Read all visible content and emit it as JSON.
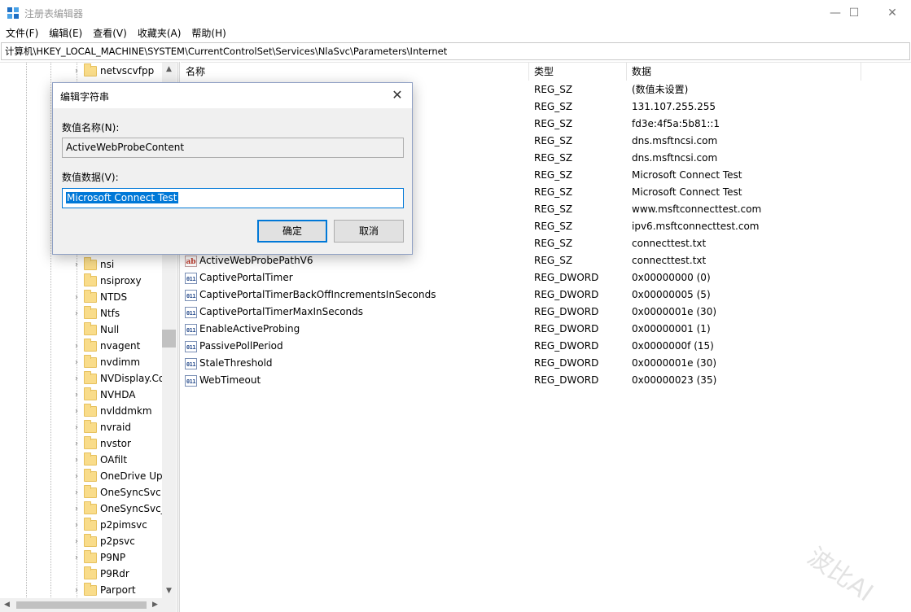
{
  "window": {
    "title": "注册表编辑器",
    "minimize_glyph": "—",
    "maximize_glyph": "☐",
    "close_glyph": "✕"
  },
  "menu": [
    {
      "label": "文件(F)"
    },
    {
      "label": "编辑(E)"
    },
    {
      "label": "查看(V)"
    },
    {
      "label": "收藏夹(A)"
    },
    {
      "label": "帮助(H)"
    }
  ],
  "address": "计算机\\HKEY_LOCAL_MACHINE\\SYSTEM\\CurrentControlSet\\Services\\NlaSvc\\Parameters\\Internet",
  "tree": {
    "items": [
      {
        "label": "netvscvfpp",
        "expandable": true
      },
      {
        "label": "nsi",
        "expandable": true
      },
      {
        "label": "nsiproxy",
        "expandable": false
      },
      {
        "label": "NTDS",
        "expandable": true
      },
      {
        "label": "Ntfs",
        "expandable": true
      },
      {
        "label": "Null",
        "expandable": false
      },
      {
        "label": "nvagent",
        "expandable": true
      },
      {
        "label": "nvdimm",
        "expandable": true
      },
      {
        "label": "NVDisplay.Co",
        "expandable": true
      },
      {
        "label": "NVHDA",
        "expandable": true
      },
      {
        "label": "nvlddmkm",
        "expandable": true
      },
      {
        "label": "nvraid",
        "expandable": true
      },
      {
        "label": "nvstor",
        "expandable": true
      },
      {
        "label": "OAfilt",
        "expandable": true
      },
      {
        "label": "OneDrive Up",
        "expandable": true
      },
      {
        "label": "OneSyncSvc",
        "expandable": true
      },
      {
        "label": "OneSyncSvc_",
        "expandable": true
      },
      {
        "label": "p2pimsvc",
        "expandable": true
      },
      {
        "label": "p2psvc",
        "expandable": true
      },
      {
        "label": "P9NP",
        "expandable": true
      },
      {
        "label": "P9Rdr",
        "expandable": false
      },
      {
        "label": "Parport",
        "expandable": true
      }
    ],
    "scroll_up_glyph": "▲",
    "scroll_down_glyph": "▼",
    "scroll_left_glyph": "◀",
    "scroll_right_glyph": "▶"
  },
  "list": {
    "headers": {
      "name": "名称",
      "type": "类型",
      "data": "数据"
    },
    "rows": [
      {
        "name": "",
        "type": "REG_SZ",
        "data": "(数值未设置)",
        "kind": "sz"
      },
      {
        "name": "",
        "type": "REG_SZ",
        "data": "131.107.255.255",
        "kind": "sz"
      },
      {
        "name": "",
        "type": "REG_SZ",
        "data": "fd3e:4f5a:5b81::1",
        "kind": "sz"
      },
      {
        "name": "",
        "type": "REG_SZ",
        "data": "dns.msftncsi.com",
        "kind": "sz"
      },
      {
        "name": "",
        "type": "REG_SZ",
        "data": "dns.msftncsi.com",
        "kind": "sz"
      },
      {
        "name": "",
        "type": "REG_SZ",
        "data": "Microsoft Connect Test",
        "kind": "sz"
      },
      {
        "name": "",
        "type": "REG_SZ",
        "data": "Microsoft Connect Test",
        "kind": "sz"
      },
      {
        "name": "",
        "type": "REG_SZ",
        "data": "www.msftconnecttest.com",
        "kind": "sz"
      },
      {
        "name": "",
        "type": "REG_SZ",
        "data": "ipv6.msftconnecttest.com",
        "kind": "sz"
      },
      {
        "name": "",
        "type": "REG_SZ",
        "data": "connecttest.txt",
        "kind": "sz"
      },
      {
        "name": "ActiveWebProbePathV6",
        "type": "REG_SZ",
        "data": "connecttest.txt",
        "kind": "sz"
      },
      {
        "name": "CaptivePortalTimer",
        "type": "REG_DWORD",
        "data": "0x00000000 (0)",
        "kind": "dword"
      },
      {
        "name": "CaptivePortalTimerBackOffIncrementsInSeconds",
        "type": "REG_DWORD",
        "data": "0x00000005 (5)",
        "kind": "dword"
      },
      {
        "name": "CaptivePortalTimerMaxInSeconds",
        "type": "REG_DWORD",
        "data": "0x0000001e (30)",
        "kind": "dword"
      },
      {
        "name": "EnableActiveProbing",
        "type": "REG_DWORD",
        "data": "0x00000001 (1)",
        "kind": "dword"
      },
      {
        "name": "PassivePollPeriod",
        "type": "REG_DWORD",
        "data": "0x0000000f (15)",
        "kind": "dword"
      },
      {
        "name": "StaleThreshold",
        "type": "REG_DWORD",
        "data": "0x0000001e (30)",
        "kind": "dword"
      },
      {
        "name": "WebTimeout",
        "type": "REG_DWORD",
        "data": "0x00000023 (35)",
        "kind": "dword"
      }
    ],
    "icon_sz_text": "ab",
    "icon_dword_text": "011"
  },
  "dialog": {
    "title": "编辑字符串",
    "close_glyph": "✕",
    "name_label": "数值名称(N):",
    "name_value": "ActiveWebProbeContent",
    "data_label": "数值数据(V):",
    "data_value": "Microsoft Connect Test",
    "ok_label": "确定",
    "cancel_label": "取消"
  },
  "watermark": "波比AI"
}
